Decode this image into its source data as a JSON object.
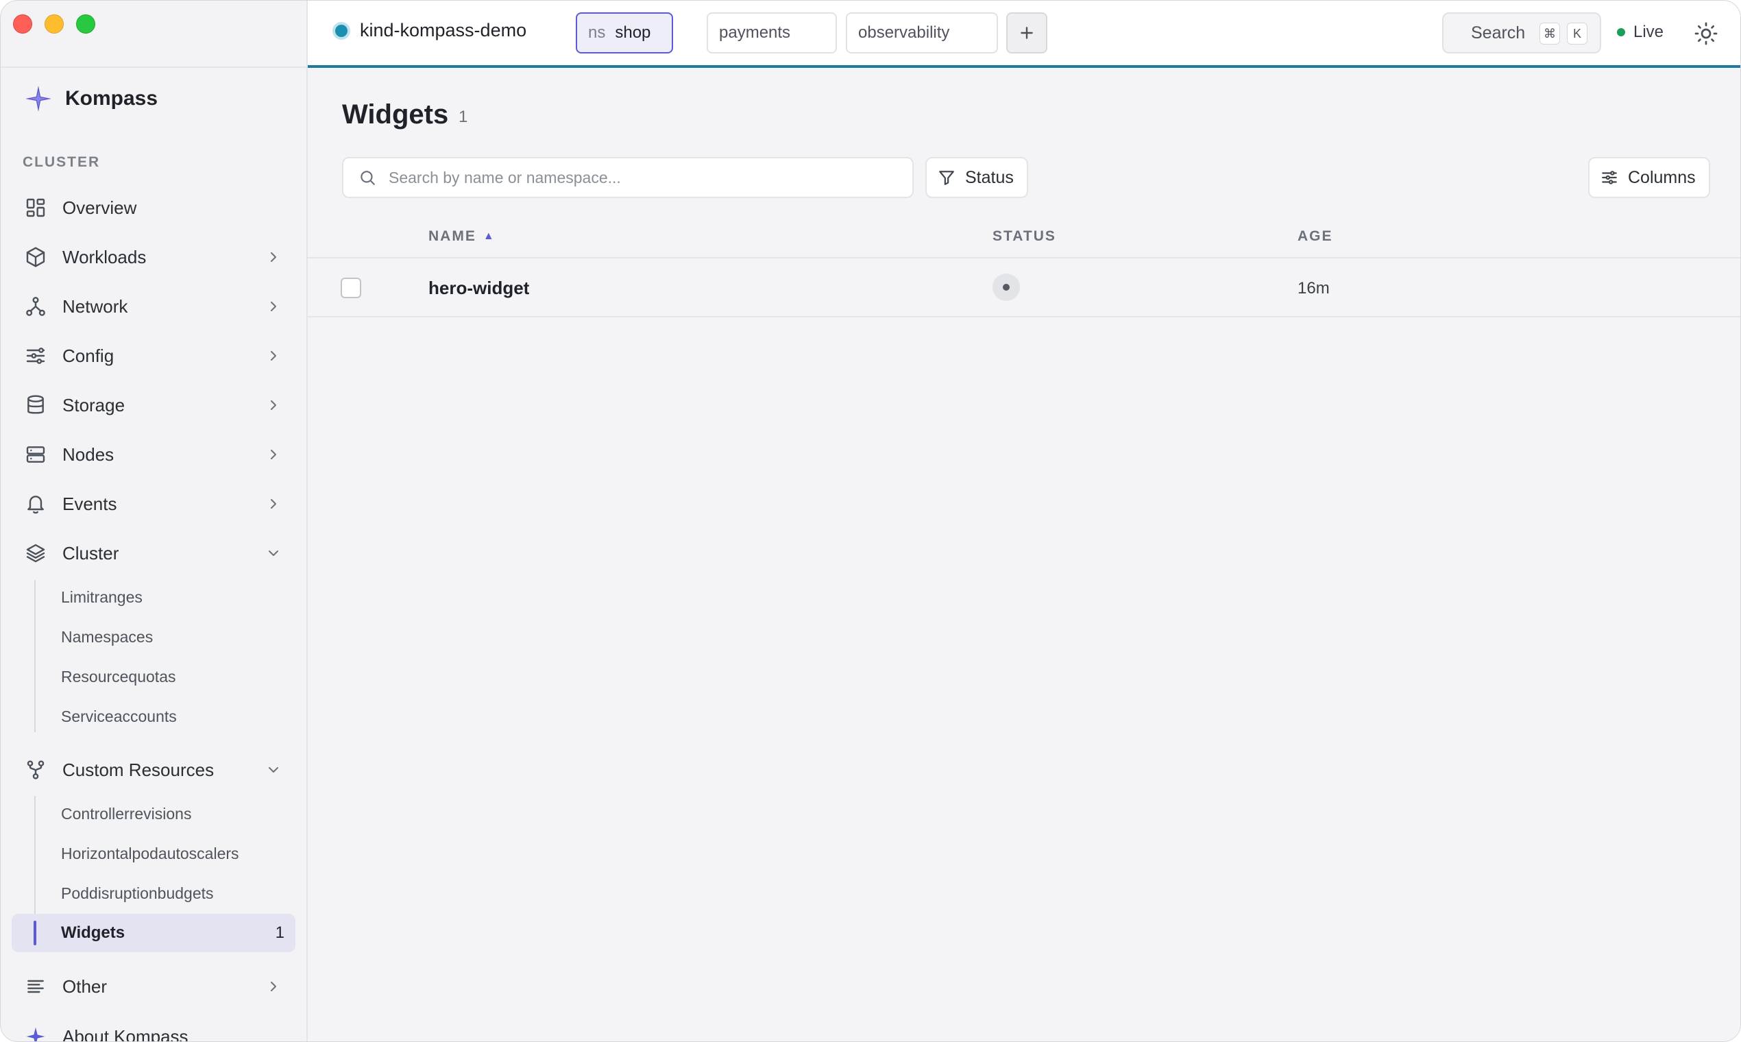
{
  "topbar": {
    "context": "kind-kompass-demo",
    "namespaces": {
      "active_prefix": "ns",
      "active": "shop",
      "others": [
        "payments",
        "observability"
      ]
    },
    "search_label": "Search",
    "search_keys": [
      "⌘",
      "K"
    ],
    "live_label": "Live"
  },
  "sidebar": {
    "brand": "Kompass",
    "section": "CLUSTER",
    "items": [
      {
        "label": "Overview",
        "icon": "grid-icon"
      },
      {
        "label": "Workloads",
        "icon": "cube-icon"
      },
      {
        "label": "Network",
        "icon": "network-icon"
      },
      {
        "label": "Config",
        "icon": "sliders-icon"
      },
      {
        "label": "Storage",
        "icon": "database-icon"
      },
      {
        "label": "Nodes",
        "icon": "server-icon"
      },
      {
        "label": "Events",
        "icon": "bell-icon"
      },
      {
        "label": "Cluster",
        "icon": "layers-icon"
      },
      {
        "label": "Custom Resources",
        "icon": "git-fork-icon"
      },
      {
        "label": "Other",
        "icon": "list-icon"
      },
      {
        "label": "About Kompass",
        "icon": "star-icon"
      }
    ],
    "cluster_sub": [
      "Limitranges",
      "Namespaces",
      "Resourcequotas",
      "Serviceaccounts"
    ],
    "custom_sub": [
      "Controllerrevisions",
      "Horizontalpodautoscalers",
      "Poddisruptionbudgets"
    ],
    "active_sub": {
      "label": "Widgets",
      "count": "1"
    }
  },
  "main": {
    "title": "Widgets",
    "count": "1",
    "search_placeholder": "Search by name or namespace...",
    "status_button": "Status",
    "columns_button": "Columns",
    "headers": {
      "name": "NAME",
      "status": "STATUS",
      "age": "AGE"
    },
    "rows": [
      {
        "name": "hero-widget",
        "age": "16m"
      }
    ]
  },
  "colors": {
    "accent": "#5b5bd6",
    "topbar_border": "#1f7a9e",
    "live": "#1a9e5a"
  }
}
